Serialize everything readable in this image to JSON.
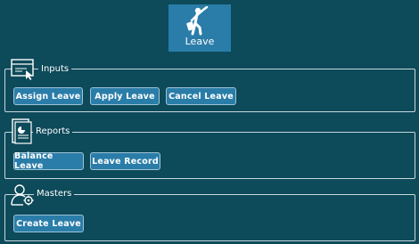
{
  "tile": {
    "label": "Leave",
    "icon": "person-walking-suitcase-icon"
  },
  "groups": [
    {
      "title": "Inputs",
      "icon": "window-cursor-icon",
      "buttons": [
        "Assign Leave",
        "Apply Leave",
        "Cancel Leave"
      ]
    },
    {
      "title": "Reports",
      "icon": "report-chart-icon",
      "buttons": [
        "Balance Leave",
        "Leave Record"
      ]
    },
    {
      "title": "Masters",
      "icon": "user-gear-icon",
      "buttons": [
        "Create Leave"
      ]
    }
  ],
  "colors": {
    "background": "#0d4a5a",
    "tile": "#2a7da8",
    "button": "#2a7da8",
    "border": "#c8d8dc"
  }
}
